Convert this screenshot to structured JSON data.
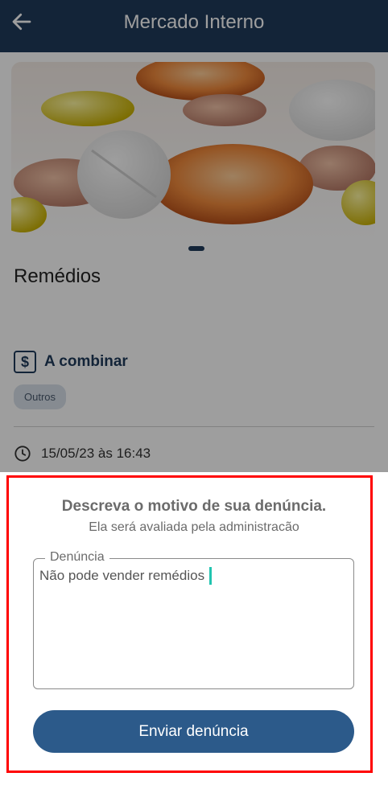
{
  "appbar": {
    "title": "Mercado Interno",
    "back_icon": "arrow-left-icon"
  },
  "listing": {
    "title": "Remédios",
    "price_icon": "dollar-icon",
    "price": "A combinar",
    "category": "Outros",
    "date_icon": "clock-icon",
    "date": "15/05/23 às 16:43"
  },
  "report_sheet": {
    "title": "Descreva o motivo de sua denúncia.",
    "subtitle": "Ela será avaliada pela administracão",
    "field_label": "Denúncia",
    "field_value": "Não pode vender remédios",
    "submit_label": "Enviar denúncia"
  },
  "colors": {
    "appbar": "#1f3b5b",
    "accent": "#2c5a8a",
    "cursor": "#22c4b0",
    "highlight": "#ff0000"
  }
}
